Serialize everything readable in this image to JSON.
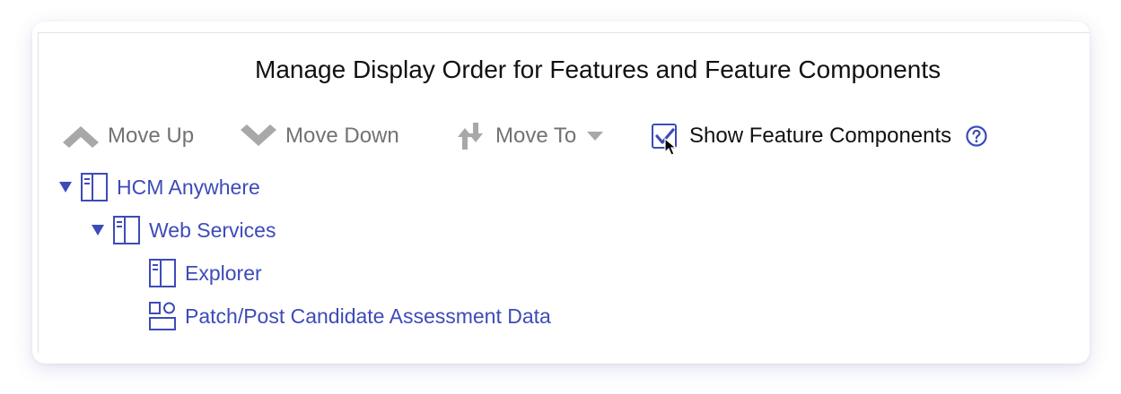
{
  "dialog": {
    "title": "Manage Display Order for Features and Feature Components"
  },
  "toolbar": {
    "move_up_label": "Move Up",
    "move_down_label": "Move Down",
    "move_to_label": "Move To",
    "show_components_label": "Show Feature Components",
    "show_components_checked": true
  },
  "tree": {
    "items": [
      {
        "label": "HCM Anywhere",
        "icon": "feature-icon",
        "expanded": true
      },
      {
        "label": "Web Services",
        "icon": "feature-icon",
        "expanded": true
      },
      {
        "label": "Explorer",
        "icon": "feature-icon"
      },
      {
        "label": "Patch/Post Candidate Assessment Data",
        "icon": "component-icon"
      }
    ]
  },
  "colors": {
    "accent": "#3d4bb8",
    "disabled": "#a8a8a8",
    "text": "#111111"
  }
}
